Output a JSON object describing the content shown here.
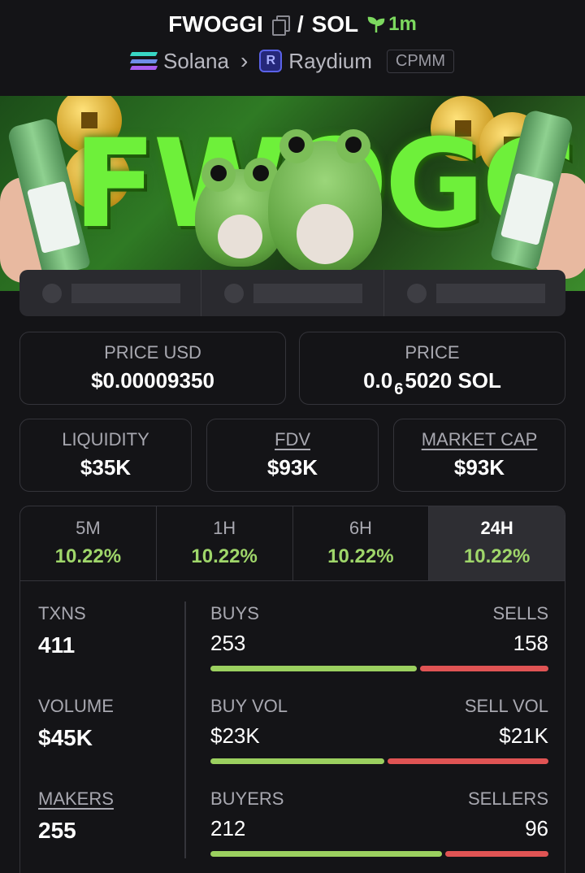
{
  "header": {
    "token": "FWOGGI",
    "separator": "/",
    "quote": "SOL",
    "age": "1m",
    "chain": "Solana",
    "dex": "Raydium",
    "dex_badge": "CPMM"
  },
  "banner": {
    "text": "FWOGGI"
  },
  "price_usd": {
    "label": "PRICE USD",
    "value": "$0.00009350"
  },
  "price": {
    "label": "PRICE",
    "prefix": "0.0",
    "zeros": "6",
    "suffix": "5020 SOL"
  },
  "liquidity": {
    "label": "LIQUIDITY",
    "value": "$35K"
  },
  "fdv": {
    "label": "FDV",
    "value": "$93K"
  },
  "market_cap": {
    "label": "MARKET CAP",
    "value": "$93K"
  },
  "timeframes": [
    {
      "label": "5M",
      "change": "10.22%"
    },
    {
      "label": "1H",
      "change": "10.22%"
    },
    {
      "label": "6H",
      "change": "10.22%"
    },
    {
      "label": "24H",
      "change": "10.22%"
    }
  ],
  "active_timeframe": "24H",
  "txns": {
    "label": "TXNS",
    "value": "411"
  },
  "volume": {
    "label": "VOLUME",
    "value": "$45K"
  },
  "makers": {
    "label": "MAKERS",
    "value": "255"
  },
  "buys": {
    "label": "BUYS",
    "value": "253",
    "sell_label": "SELLS",
    "sell_value": "158",
    "buy_fraction": 0.615
  },
  "buy_vol": {
    "label": "BUY VOL",
    "value": "$23K",
    "sell_label": "SELL VOL",
    "sell_value": "$21K",
    "buy_fraction": 0.52
  },
  "buyers": {
    "label": "BUYERS",
    "value": "212",
    "sell_label": "SELLERS",
    "sell_value": "96",
    "buy_fraction": 0.69
  },
  "colors": {
    "positive": "#9fd66a",
    "negative": "#e05454",
    "background": "#141417"
  }
}
